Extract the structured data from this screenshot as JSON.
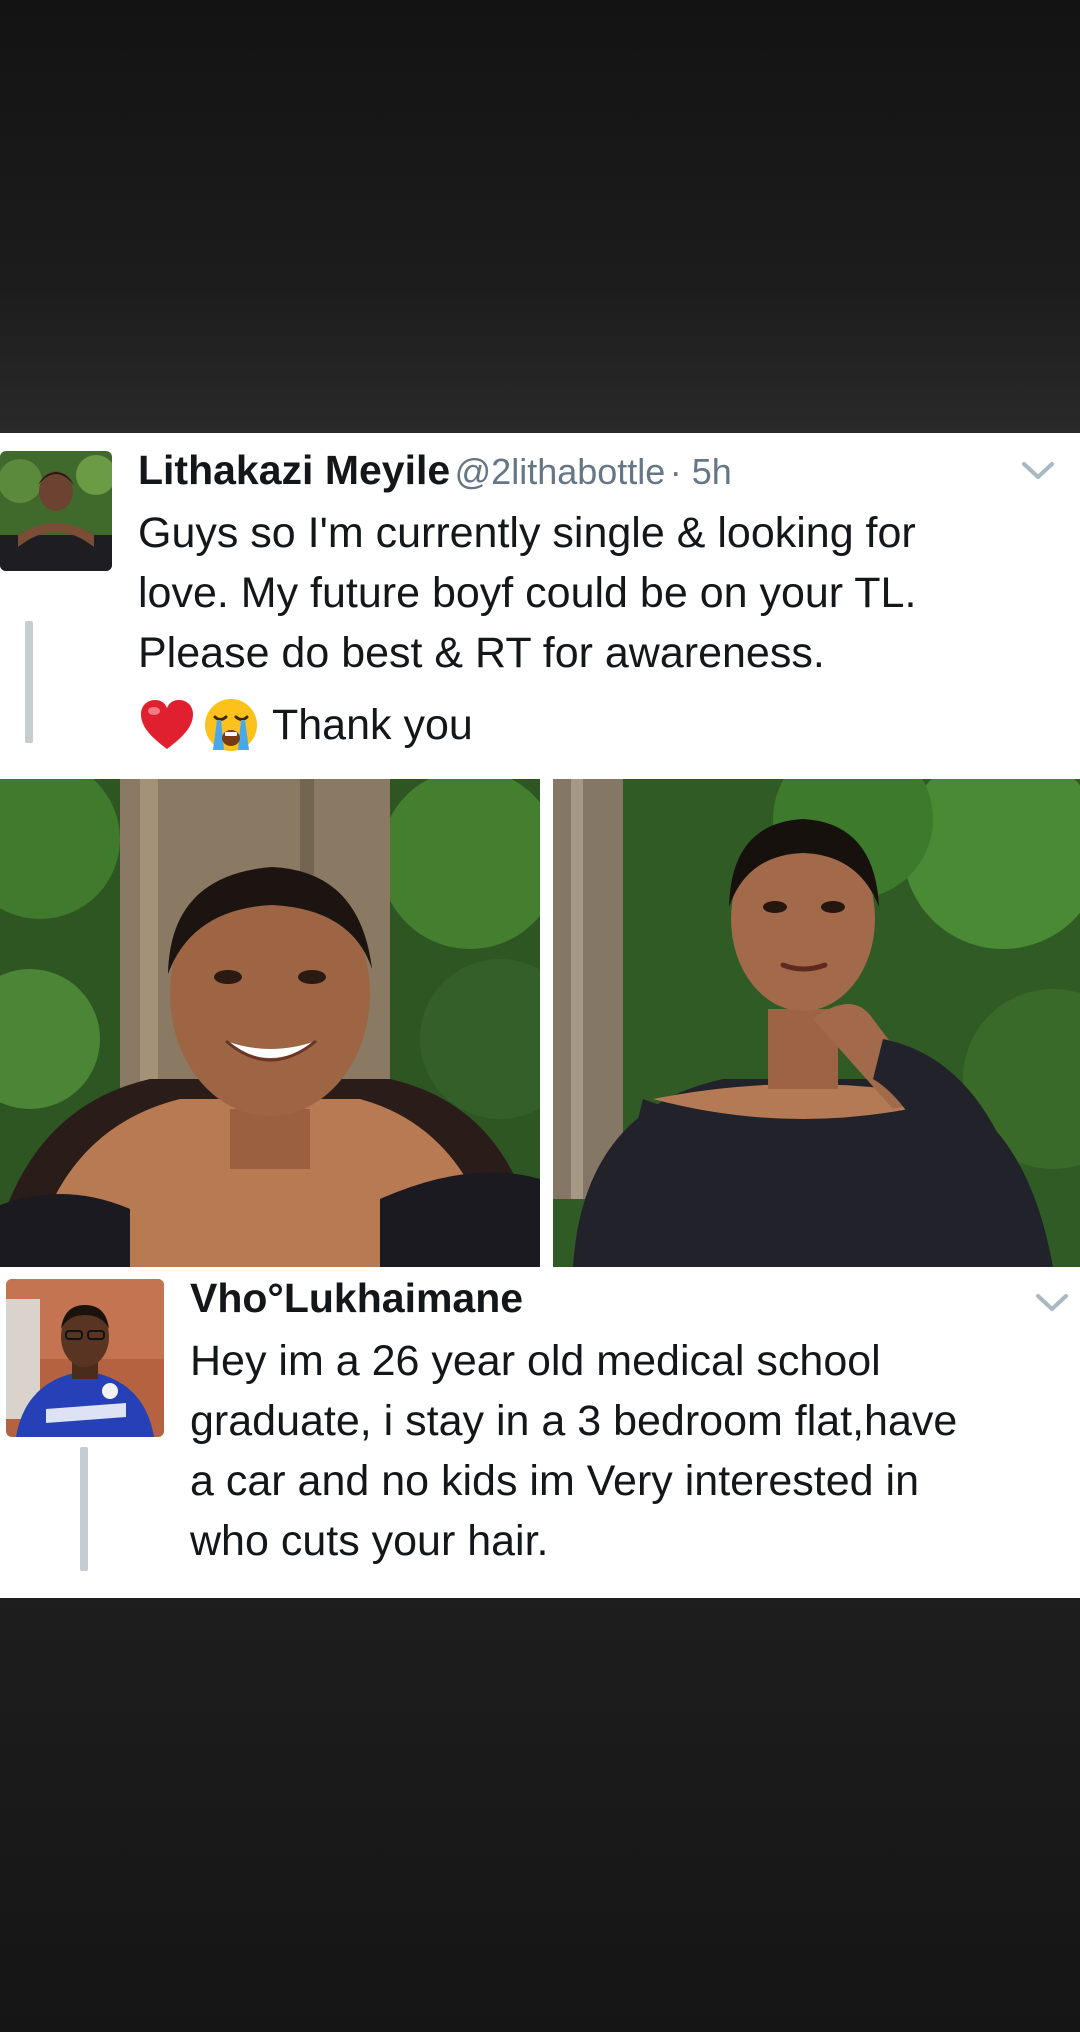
{
  "tweet": {
    "author_name": "Lithakazi Meyile",
    "author_handle": "@2lithabottle",
    "time": "· 5h",
    "lines": [
      "Guys so I'm currently single & looking for",
      "love. My future boyf could be on your TL.",
      "Please do best & RT for awareness."
    ],
    "sign_off": "Thank you",
    "emojis": [
      "red-heart",
      "loudly-crying-face"
    ],
    "avatar_icon": "profile-photo-woman",
    "photos": [
      "photo-smiling-woman",
      "photo-posing-woman"
    ]
  },
  "reply": {
    "author_name": "Vho°Lukhaimane",
    "lines": [
      "Hey im a 26 year old medical school",
      "graduate, i stay in a 3 bedroom flat,have",
      "a car and no kids im Very interested in",
      "who cuts your hair."
    ],
    "avatar_icon": "profile-photo-man"
  },
  "colors": {
    "name": "#14171a",
    "handle": "#657786",
    "thread_line": "#c7ccd1",
    "chevron": "#aab8c2",
    "card": "#ffffff"
  }
}
